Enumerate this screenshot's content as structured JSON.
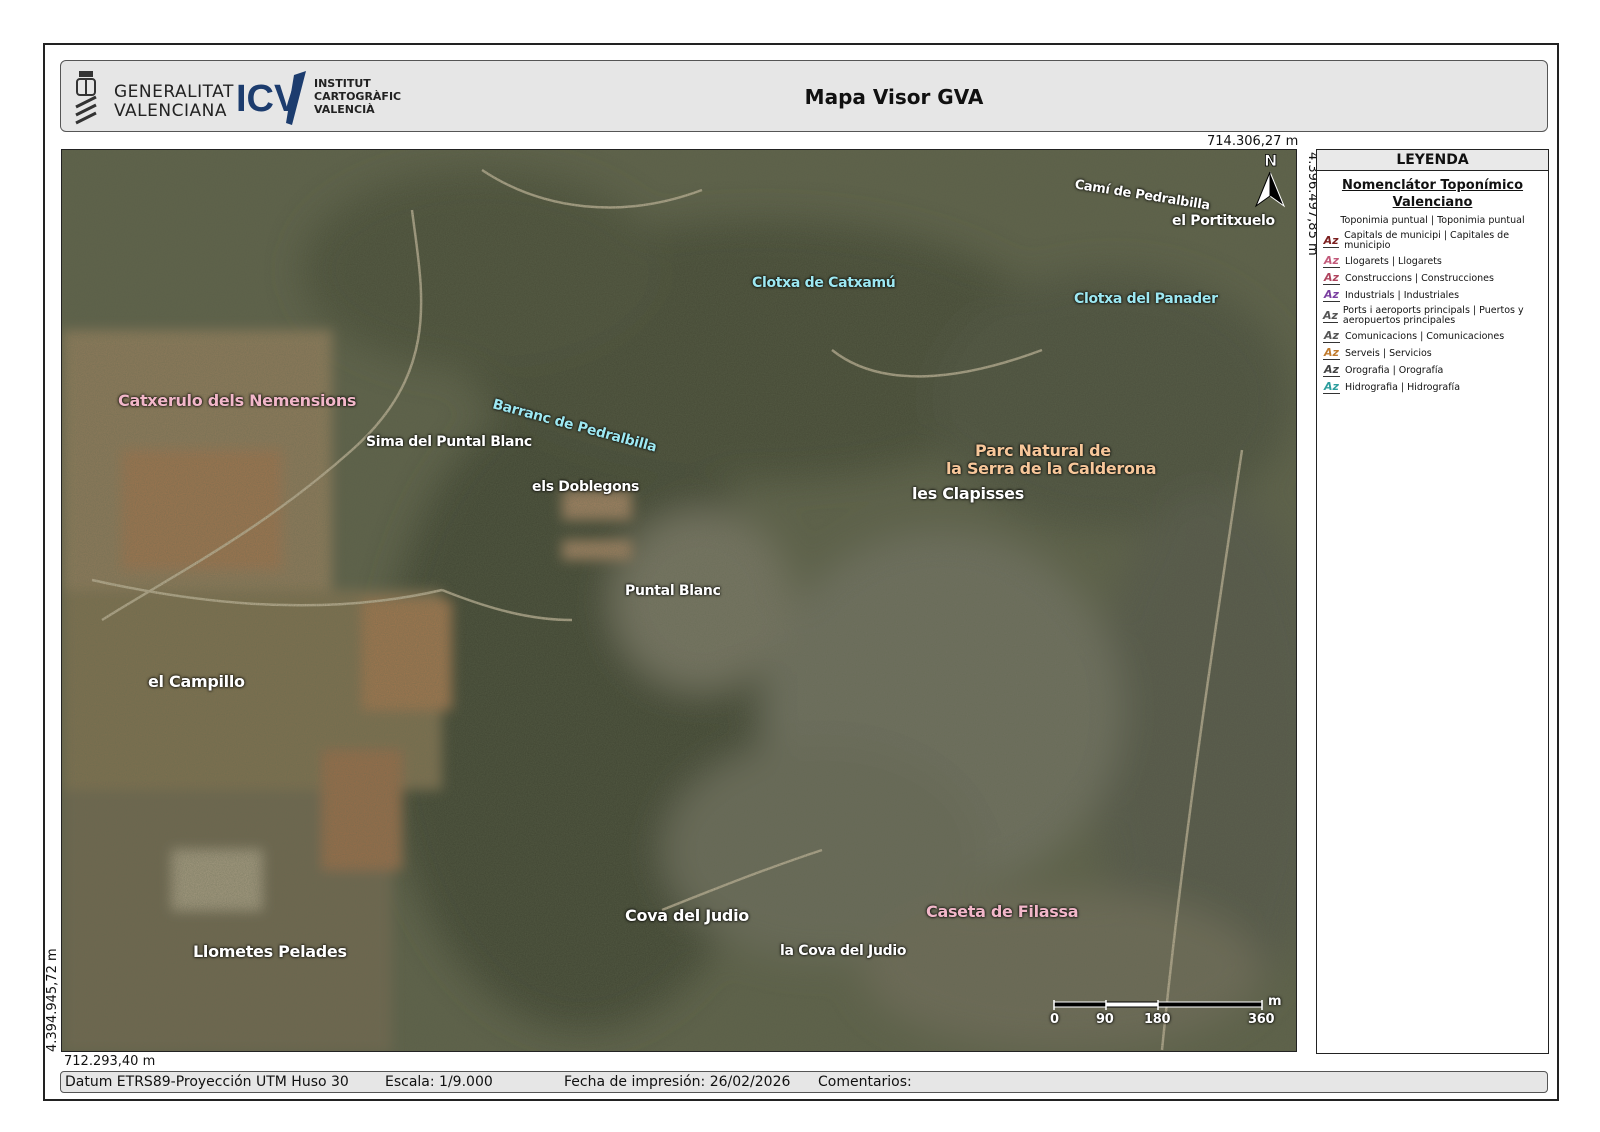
{
  "header": {
    "gva_name_line1": "GENERALITAT",
    "gva_name_line2": "VALENCIANA",
    "icv_abbr": "ICV",
    "icv_line1": "INSTITUT",
    "icv_line2": "CARTOGRÀFIC",
    "icv_line3": "VALENCIÀ",
    "title": "Mapa Visor GVA"
  },
  "coordinates": {
    "top_right_x": "714.306,27 m",
    "top_right_y": "4.396.497,85 m",
    "bottom_left_y": "4.394.945,72 m",
    "bottom_left_x": "712.293,40 m"
  },
  "map_labels": {
    "cami_pedralbilla": "Camí de Pedralbilla",
    "portitxuelo": "el Portitxuelo",
    "clotxa_catxamu": "Clotxa de Catxamú",
    "clotxa_panader": "Clotxa del Panader",
    "catxerulo": "Catxerulo dels Nemensions",
    "barranc": "Barranc de Pedralbilla",
    "sima": "Sima del Puntal Blanc",
    "doblegons": "els Doblegons",
    "parc_line1": "Parc Natural de",
    "parc_line2": "la Serra de la Calderona",
    "clapisses": "les Clapisses",
    "puntal_blanc": "Puntal Blanc",
    "campillo": "el Campillo",
    "cova_judio": "Cova del Judio",
    "caseta": "Caseta de Filassa",
    "la_cova": "la Cova del Judio",
    "llometes": "Llometes Pelades"
  },
  "north_arrow": {
    "letter": "N"
  },
  "scale_bar": {
    "unit": "m",
    "ticks": [
      "0",
      "90",
      "180",
      "360"
    ]
  },
  "legend": {
    "title": "LEYENDA",
    "layer": "Nomenclátor Toponímico Valenciano",
    "subtitle": "Toponimia puntual | Toponimia puntual",
    "items": [
      {
        "label": "Capitals de municipi | Capitales de municipio",
        "color": "#7a1e1e"
      },
      {
        "label": "Llogarets | Llogarets",
        "color": "#c25a7a"
      },
      {
        "label": "Construccions | Construcciones",
        "color": "#b0455f"
      },
      {
        "label": "Industrials | Industriales",
        "color": "#7b3fa0"
      },
      {
        "label": "Ports i aeroports principals | Puertos y aeropuertos principales",
        "color": "#555555"
      },
      {
        "label": "Comunicacions | Comunicaciones",
        "color": "#555555"
      },
      {
        "label": "Serveis | Servicios",
        "color": "#c07b2e"
      },
      {
        "label": "Orografia | Orografía",
        "color": "#444444"
      },
      {
        "label": "Hidrografia | Hidrografía",
        "color": "#2e9e9e"
      }
    ]
  },
  "footer": {
    "datum": "Datum ETRS89-Proyección UTM Huso 30",
    "escala": "Escala: 1/9.000",
    "fecha": "Fecha de impresión: 26/02/2026",
    "comentarios": "Comentarios:"
  }
}
